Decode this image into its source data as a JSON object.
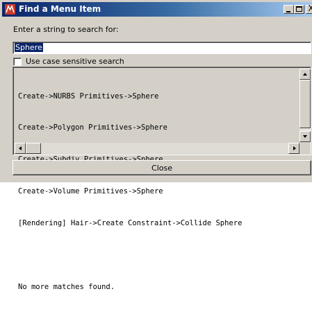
{
  "window": {
    "title": "Find a Menu Item",
    "app_icon": "maya-app-icon",
    "controls": {
      "minimize_icon": "minimize-icon",
      "maximize_icon": "maximize-icon",
      "close_glyph": "X"
    }
  },
  "search": {
    "prompt": "Enter a string to search for:",
    "value": "Sphere"
  },
  "options": {
    "case_sensitive_label": "Use case sensitive search",
    "case_sensitive_checked": false
  },
  "results": {
    "lines": [
      "Create->NURBS Primitives->Sphere",
      "Create->Polygon Primitives->Sphere",
      "Create->Subdiv Primitives->Sphere",
      "Create->Volume Primitives->Sphere",
      "[Rendering] Hair->Create Constraint->Collide Sphere",
      "",
      "No more matches found."
    ]
  },
  "footer": {
    "close_label": "Close"
  },
  "colors": {
    "titlebar_start": "#0a246a",
    "titlebar_end": "#a6caf0",
    "face": "#d4d0c8",
    "selection": "#0a246a"
  }
}
